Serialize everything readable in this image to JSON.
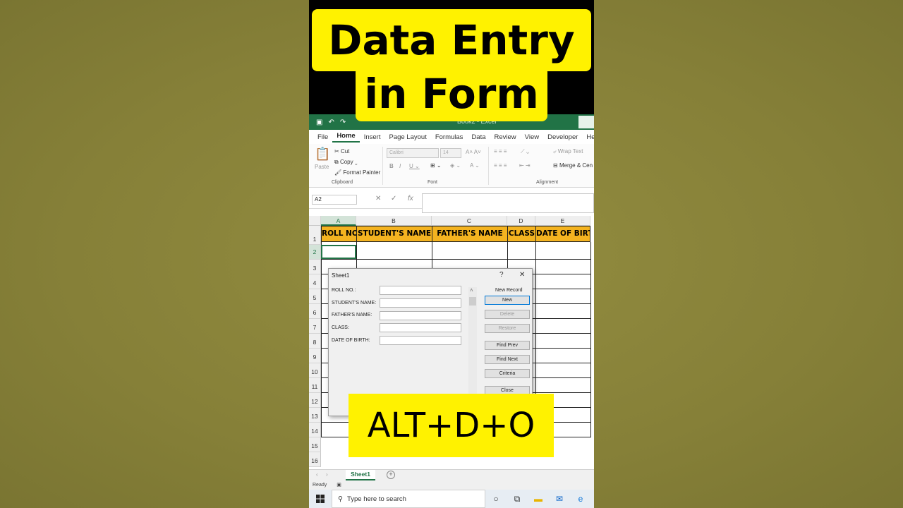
{
  "banner": {
    "line1": "Data Entry",
    "line2": "in Form"
  },
  "hotkey": "ALT+D+O",
  "excel": {
    "doc_title": "Book2 - Excel",
    "tabs": [
      "File",
      "Home",
      "Insert",
      "Page Layout",
      "Formulas",
      "Data",
      "Review",
      "View",
      "Developer",
      "Hel"
    ],
    "active_tab": "Home",
    "ribbon": {
      "paste": "Paste",
      "cut": "Cut",
      "copy": "Copy",
      "format_painter": "Format Painter",
      "clipboard_label": "Clipboard",
      "font_name": "Calibri",
      "font_size": "14",
      "font_label": "Font",
      "wrap_text": "Wrap Text",
      "merge_center": "Merge & Cen",
      "alignment_label": "Alignment"
    },
    "name_box": "A2",
    "columns": [
      "A",
      "B",
      "C",
      "D",
      "E"
    ],
    "rows": [
      "1",
      "2",
      "3",
      "4",
      "5",
      "6",
      "7",
      "8",
      "9",
      "10",
      "11",
      "12",
      "13",
      "14",
      "15",
      "16"
    ],
    "headers": [
      "ROLL NO.",
      "STUDENT'S NAME",
      "FATHER'S NAME",
      "CLASS",
      "DATE OF BIRTH"
    ],
    "sheet_tab": "Sheet1",
    "status": "Ready"
  },
  "dialog": {
    "title": "Sheet1",
    "help": "?",
    "close_x": "✕",
    "fields": [
      "ROLL NO.:",
      "STUDENT'S NAME:",
      "FATHER'S NAME:",
      "CLASS:",
      "DATE OF BIRTH:"
    ],
    "record_label": "New Record",
    "buttons": {
      "new": "New",
      "delete": "Delete",
      "restore": "Restore",
      "find_prev": "Find Prev",
      "find_next": "Find Next",
      "criteria": "Criteria",
      "close": "Close"
    }
  },
  "taskbar": {
    "search_placeholder": "Type here to search"
  },
  "colors": {
    "excel_green": "#217346",
    "header_fill": "#f4b320",
    "banner_yellow": "#fff200"
  }
}
